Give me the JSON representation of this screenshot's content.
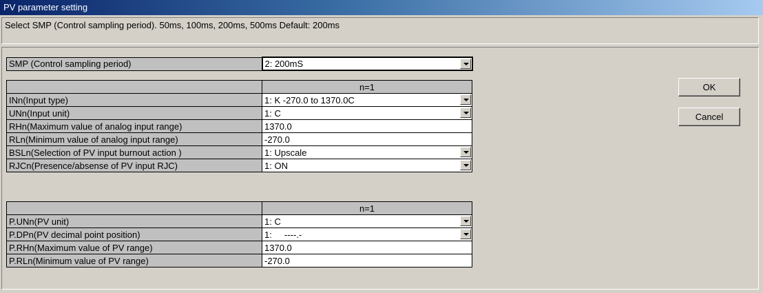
{
  "window": {
    "title": "PV parameter setting"
  },
  "hint": "Select SMP (Control sampling period).  50ms, 100ms, 200ms, 500ms  Default: 200ms",
  "smp": {
    "label": "SMP (Control sampling period)",
    "value": "2: 200mS"
  },
  "input_table": {
    "header": "n=1",
    "rows": [
      {
        "label": "INn(Input type)",
        "value": "1: K   -270.0 to 1370.0C"
      },
      {
        "label": "UNn(Input unit)",
        "value": "1: C"
      },
      {
        "label": "RHn(Maximum value of analog input range)",
        "value": "1370.0"
      },
      {
        "label": "RLn(Minimum value of analog input range)",
        "value": "-270.0"
      },
      {
        "label": "BSLn(Selection of PV input burnout action )",
        "value": "1: Upscale"
      },
      {
        "label": "RJCn(Presence/absense of PV input RJC)",
        "value": "1: ON"
      }
    ]
  },
  "pv_table": {
    "header": "n=1",
    "rows": [
      {
        "label": "P.UNn(PV unit)",
        "value": "1: C"
      },
      {
        "label": "P.DPn(PV decimal point position)",
        "value": "1:     ----.-"
      },
      {
        "label": "P.RHn(Maximum value of PV range)",
        "value": "1370.0"
      },
      {
        "label": "P.RLn(Minimum value of PV range)",
        "value": "-270.0"
      }
    ]
  },
  "buttons": {
    "ok": "OK",
    "cancel": "Cancel"
  },
  "colors": {
    "title_start": "#0a246a",
    "title_end": "#a6caf0",
    "face": "#d4d0c8",
    "label_bg": "#c0c0c0"
  }
}
